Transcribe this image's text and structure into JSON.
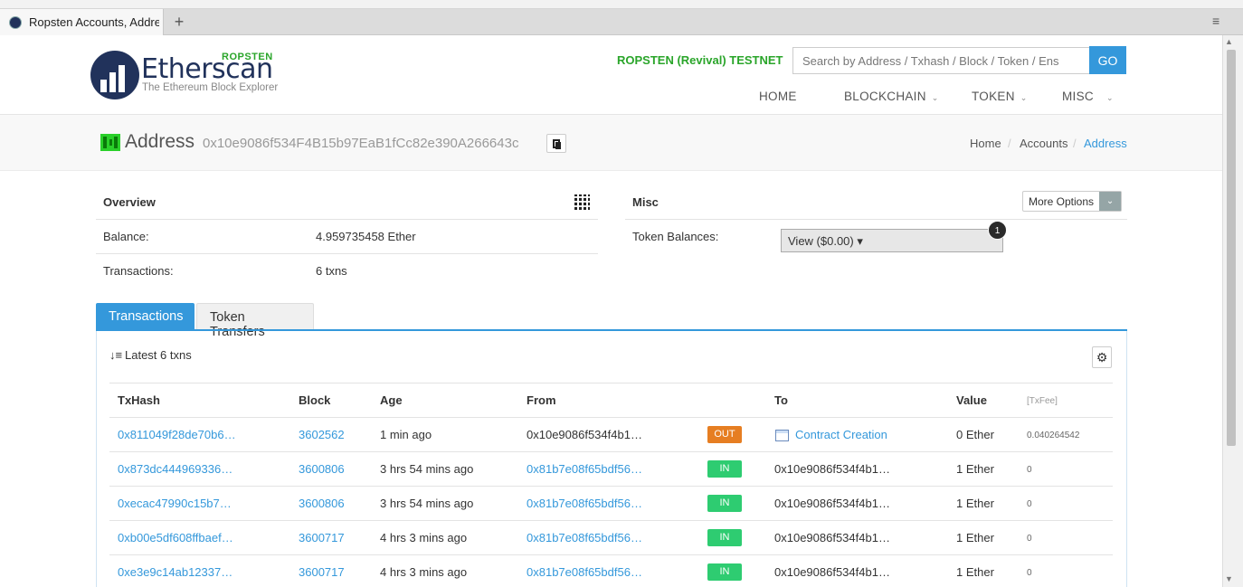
{
  "browser": {
    "tab_title": "Ropsten Accounts, Address",
    "new_tab": "+",
    "menu": "≡"
  },
  "header": {
    "logo_text": "Etherscan",
    "logo_badge": "ROPSTEN",
    "logo_sub": "The Ethereum Block Explorer",
    "network": "ROPSTEN (Revival) TESTNET",
    "search_placeholder": "Search by Address / Txhash / Block / Token / Ens",
    "search_button": "GO",
    "nav": [
      {
        "label": "HOME"
      },
      {
        "label": "BLOCKCHAIN"
      },
      {
        "label": "TOKEN"
      },
      {
        "label": "MISC"
      }
    ]
  },
  "page": {
    "title": "Address",
    "address": "0x10e9086f534F4B15b97EaB1fCc82e390A266643c",
    "breadcrumb": [
      "Home",
      "Accounts",
      "Address"
    ]
  },
  "overview": {
    "title": "Overview",
    "balance_label": "Balance:",
    "balance_value": "4.959735458 Ether",
    "txns_label": "Transactions:",
    "txns_value": "6 txns"
  },
  "misc": {
    "title": "Misc",
    "more_options": "More Options",
    "token_label": "Token Balances:",
    "token_select": "View ($0.00)",
    "badge_count": "1"
  },
  "tabs": [
    {
      "label": "Transactions"
    },
    {
      "label": "Token Transfers"
    }
  ],
  "txlist": {
    "summary": "Latest 6 txns",
    "columns": [
      "TxHash",
      "Block",
      "Age",
      "From",
      "To",
      "Value",
      "[TxFee]"
    ],
    "rows": [
      {
        "hash": "0x811049f28de70b6…",
        "block": "3602562",
        "age": "1 min ago",
        "from": "0x10e9086f534f4b1…",
        "dir": "OUT",
        "to": "Contract Creation",
        "value": "0 Ether",
        "fee": "0.040264542"
      },
      {
        "hash": "0x873dc444969336…",
        "block": "3600806",
        "age": "3 hrs 54 mins ago",
        "from": "0x81b7e08f65bdf56…",
        "dir": "IN",
        "to": "0x10e9086f534f4b1…",
        "value": "1 Ether",
        "fee": "0"
      },
      {
        "hash": "0xecac47990c15b7…",
        "block": "3600806",
        "age": "3 hrs 54 mins ago",
        "from": "0x81b7e08f65bdf56…",
        "dir": "IN",
        "to": "0x10e9086f534f4b1…",
        "value": "1 Ether",
        "fee": "0"
      },
      {
        "hash": "0xb00e5df608ffbaef…",
        "block": "3600717",
        "age": "4 hrs 3 mins ago",
        "from": "0x81b7e08f65bdf56…",
        "dir": "IN",
        "to": "0x10e9086f534f4b1…",
        "value": "1 Ether",
        "fee": "0"
      },
      {
        "hash": "0xe3e9c14ab12337…",
        "block": "3600717",
        "age": "4 hrs 3 mins ago",
        "from": "0x81b7e08f65bdf56…",
        "dir": "IN",
        "to": "0x10e9086f534f4b1…",
        "value": "1 Ether",
        "fee": "0"
      }
    ]
  },
  "colors": {
    "accent": "#3498db",
    "brand": "#21325b",
    "network_green": "#2aa52a",
    "out_badge": "#e67e22",
    "in_badge": "#2ecc71"
  }
}
